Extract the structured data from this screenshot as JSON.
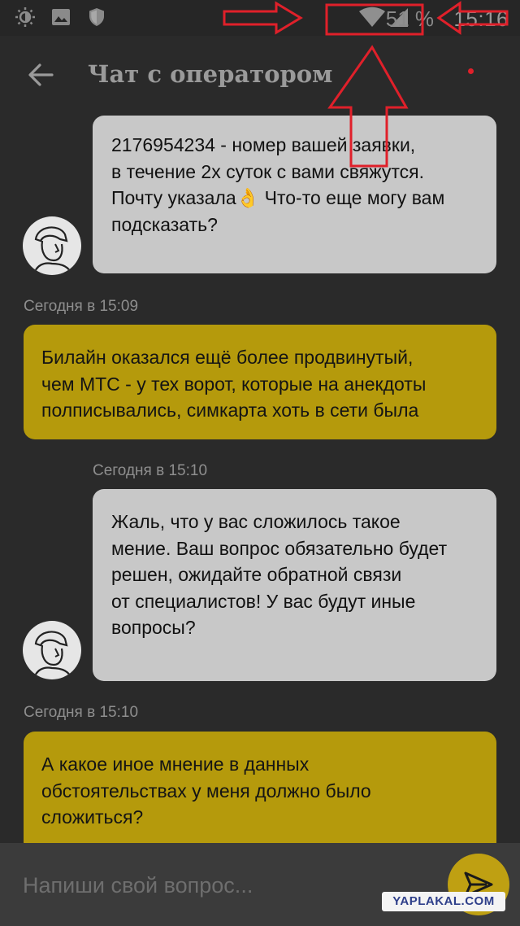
{
  "status_bar": {
    "time": "15:16",
    "battery": "51 %",
    "icons": [
      "brightness-icon",
      "image-icon",
      "shield-icon",
      "wifi-icon",
      "signal-icon"
    ]
  },
  "header": {
    "title": "Чат с оператором",
    "back_icon": "back-arrow-icon"
  },
  "messages": [
    {
      "sender": "operator",
      "lines": [
        "2176954234 - номер вашей заявки,",
        "в течение 2х суток с вами свяжутся.",
        "Почту указала👌 Что-то еще могу вам",
        "подсказать?"
      ]
    },
    {
      "sender": "user",
      "timestamp": "Сегодня в 15:09",
      "lines": [
        "Билайн оказался ещё более продвинутый,",
        "чем МТС - у тех ворот, которые на анекдоты",
        "полписывались, симкарта хоть в сети была"
      ]
    },
    {
      "sender": "operator",
      "timestamp": "Сегодня в 15:10",
      "lines": [
        "Жаль, что у вас сложилось такое",
        "мение. Ваш вопрос обязательно будет",
        "решен, ожидайте обратной связи",
        "от специалистов! У вас будут иные",
        "вопросы?"
      ]
    },
    {
      "sender": "user",
      "timestamp": "Сегодня в 15:10",
      "lines": [
        "А какое иное мнение в данных",
        "обстоятельствах у меня должно было",
        "сложиться?"
      ]
    }
  ],
  "input": {
    "placeholder": "Напиши свой вопрос..."
  },
  "watermark": "YAPLAKAL.COM",
  "colors": {
    "background": "#2a2a2a",
    "operator_bubble": "#c8c8c8",
    "user_bubble": "#b59a0c",
    "send_button": "#bfa012",
    "annotation": "#e0202a"
  }
}
